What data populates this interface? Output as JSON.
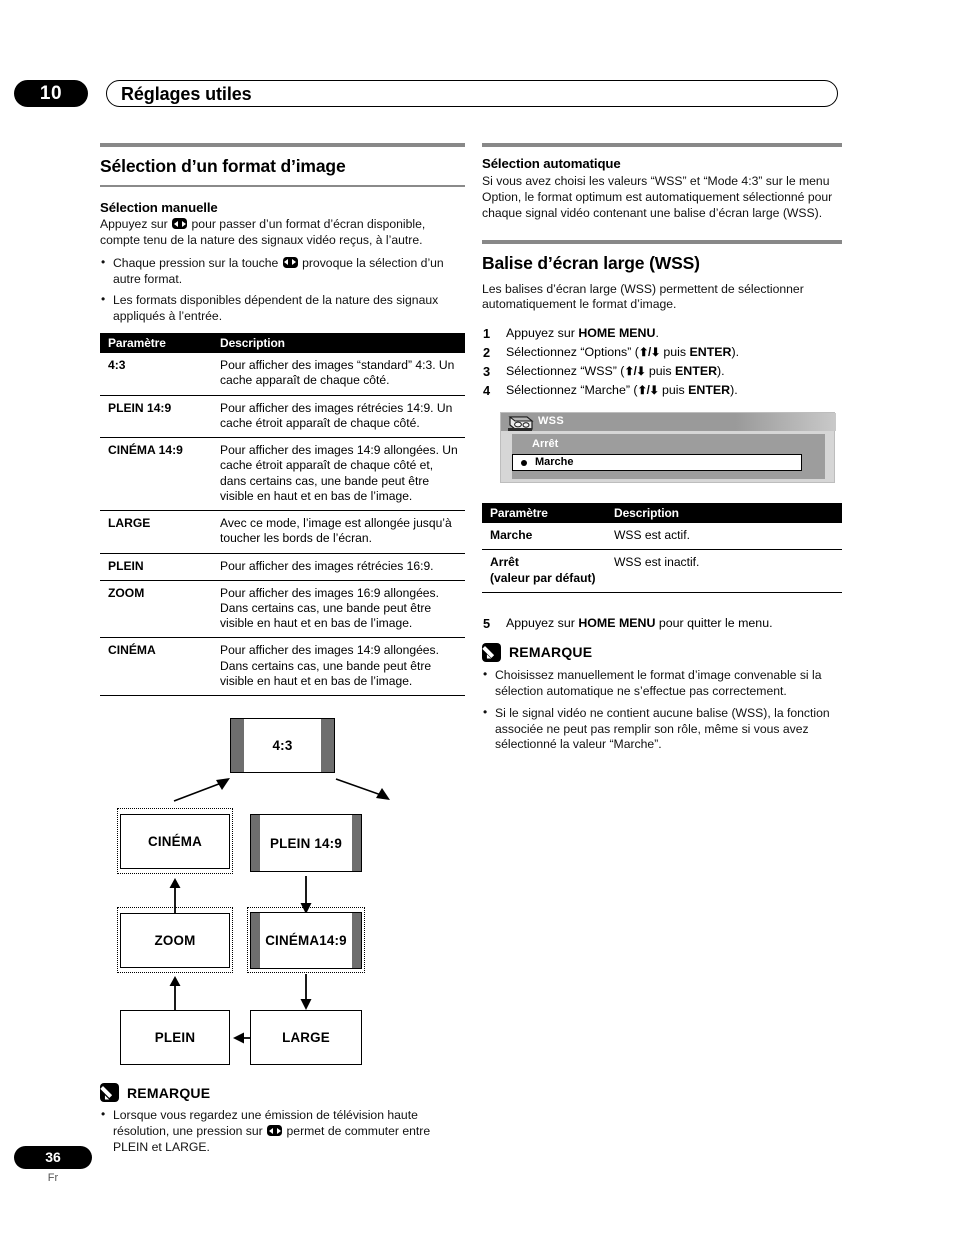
{
  "header": {
    "chapter_number": "10",
    "chapter_title": "Réglages utiles"
  },
  "footer": {
    "page_number": "36",
    "language_code": "Fr"
  },
  "left_column": {
    "section_title": "Sélection d’un format d’image",
    "manual": {
      "heading": "Sélection manuelle",
      "intro_before_icon": "Appuyez sur",
      "intro_after_icon": "pour passer d’un format d’écran disponible, compte tenu de la nature des signaux vidéo reçus, à l’autre.",
      "bullet1_before_icon": "Chaque pression sur la touche",
      "bullet1_after_icon": "provoque la sélection d’un autre format.",
      "bullet2": "Les formats disponibles dépendent de la nature des signaux appliqués à l’entrée."
    },
    "format_table": {
      "headers": [
        "Paramètre",
        "Description"
      ],
      "rows": [
        {
          "param": "4:3",
          "desc": "Pour afficher des images “standard” 4:3. Un cache apparaît de chaque côté."
        },
        {
          "param": "PLEIN 14:9",
          "desc": "Pour afficher des images rétrécies 14:9. Un cache étroit apparaît de chaque côté."
        },
        {
          "param": "CINÉMA 14:9",
          "desc": "Pour afficher des images 14:9 allongées. Un cache étroit apparaît de chaque côté et, dans certains cas, une bande peut être visible en haut et en bas de l’image."
        },
        {
          "param": "LARGE",
          "desc": "Avec ce mode, l’image est allongée jusqu’à toucher les bords de l’écran."
        },
        {
          "param": "PLEIN",
          "desc": "Pour afficher des images rétrécies 16:9."
        },
        {
          "param": "ZOOM",
          "desc": "Pour afficher des images 16:9 allongées. Dans certains cas, une bande peut être visible en haut et en bas de l’image."
        },
        {
          "param": "CINÉMA",
          "desc": "Pour afficher des images 14:9 allongées. Dans certains cas, une bande peut être visible en haut et en bas de l’image."
        }
      ]
    },
    "diagram": {
      "box_43": "4:3",
      "box_cinema": "CINÉMA",
      "box_plein149": "PLEIN 14:9",
      "box_zoom": "ZOOM",
      "box_cinema149": "CINÉMA14:9",
      "box_plein": "PLEIN",
      "box_large": "LARGE"
    },
    "remark": {
      "label": "REMARQUE",
      "bullet1_before_icon": "Lorsque vous regardez une émission de télévision haute résolution, une pression sur",
      "bullet1_after_icon": "permet de commuter entre PLEIN et LARGE."
    }
  },
  "right_column": {
    "auto": {
      "heading": "Sélection automatique",
      "body": "Si vous avez choisi les valeurs “WSS” et “Mode 4:3” sur le menu Option, le format optimum est automatiquement sélectionné pour chaque signal vidéo contenant une balise d’écran large (WSS)."
    },
    "wss_section": {
      "section_title": "Balise d’écran large (WSS)",
      "body": "Les balises d’écran large (WSS) permettent de sélectionner automatiquement le format d’image."
    },
    "steps": [
      {
        "num": "1",
        "pre": "Appuyez sur ",
        "bold1": "HOME MENU",
        "post": "."
      },
      {
        "num": "2",
        "pre": "Sélectionnez “Options” (",
        "arrows": "⬆/⬇",
        "mid": " puis ",
        "bold1": "ENTER",
        "post": ")."
      },
      {
        "num": "3",
        "pre": "Sélectionnez “WSS” (",
        "arrows": "⬆/⬇",
        "mid": " puis ",
        "bold1": "ENTER",
        "post": ")."
      },
      {
        "num": "4",
        "pre": "Sélectionnez “Marche” (",
        "arrows": "⬆/⬇",
        "mid": " puis ",
        "bold1": "ENTER",
        "post": ")."
      }
    ],
    "final_step": {
      "num": "5",
      "pre": "Appuyez sur ",
      "bold1": "HOME MENU",
      "post": " pour quitter le menu."
    },
    "osd": {
      "title": "WSS",
      "icon_name": "tv-device-icon",
      "option_off": "Arrêt",
      "option_on": "Marche"
    },
    "wss_table": {
      "headers": [
        "Paramètre",
        "Description"
      ],
      "rows": [
        {
          "param": "Marche",
          "param2": "",
          "desc": "WSS est actif."
        },
        {
          "param": "Arrêt",
          "param2": "(valeur par défaut)",
          "desc": "WSS est inactif."
        }
      ]
    },
    "remark": {
      "label": "REMARQUE",
      "bullet1": "Choisissez manuellement le format d’image convenable si la sélection automatique ne s’effectue pas correctement.",
      "bullet2": "Si le signal vidéo ne contient aucune balise (WSS), la fonction associée ne peut pas remplir son rôle, même si vous avez sélectionné la valeur “Marche”."
    }
  },
  "colors": {
    "rule_gray": "#888888",
    "osd_titlebar": "#9a9a9a",
    "osd_body": "#9d9d9d",
    "tv_bar_gray": "#6e6e6e",
    "black": "#000000"
  }
}
